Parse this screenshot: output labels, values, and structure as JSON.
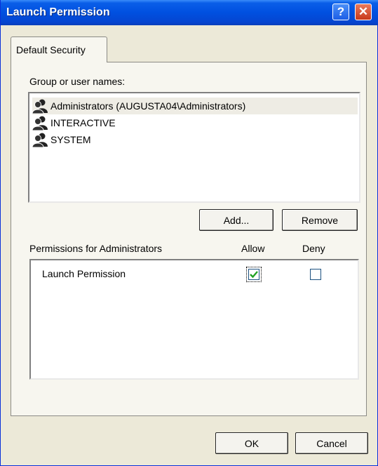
{
  "window": {
    "title": "Launch Permission",
    "help_glyph": "?",
    "close_glyph": "✕"
  },
  "tabs": [
    {
      "label": "Default Security"
    }
  ],
  "group_section": {
    "label": "Group or user names:",
    "users": [
      {
        "name": "Administrators (AUGUSTA04\\Administrators)",
        "icon": "user-group-icon",
        "selected": true
      },
      {
        "name": "INTERACTIVE",
        "icon": "user-group-icon",
        "selected": false
      },
      {
        "name": "SYSTEM",
        "icon": "user-group-icon",
        "selected": false
      }
    ],
    "add_label": "Add...",
    "remove_label": "Remove"
  },
  "permissions": {
    "label": "Permissions for Administrators",
    "allow_header": "Allow",
    "deny_header": "Deny",
    "rows": [
      {
        "name": "Launch Permission",
        "allow": true,
        "deny": false
      }
    ]
  },
  "footer": {
    "ok_label": "OK",
    "cancel_label": "Cancel"
  },
  "colors": {
    "title_bar": "#0050e0",
    "dialog_bg": "#ece9d8",
    "check_mark": "#21a121"
  }
}
